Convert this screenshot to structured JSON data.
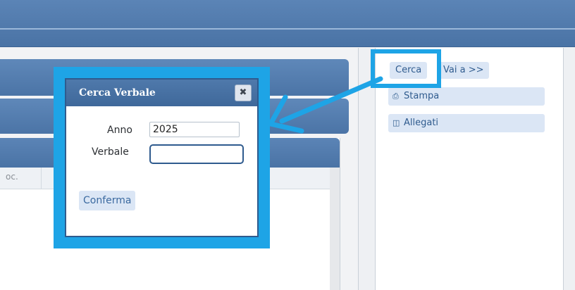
{
  "topbar": {},
  "main": {
    "column_header": "oc."
  },
  "right_panel": {
    "cerca_label": "Cerca",
    "vai_label": "Vai a >>",
    "stampa_label": "Stampa",
    "allegati_label": "Allegati",
    "icons": {
      "stampa": "printer-icon",
      "allegati": "attachment-icon"
    }
  },
  "dialog": {
    "title": "Cerca Verbale",
    "close_symbol": "✖",
    "anno_label": "Anno",
    "anno_value": "2025",
    "verbale_label": "Verbale",
    "verbale_value": "",
    "confirm_label": "Conferma"
  },
  "colors": {
    "highlight": "#1ea4e6",
    "header": "#4a73a5",
    "button_bg": "#dbe6f5"
  }
}
